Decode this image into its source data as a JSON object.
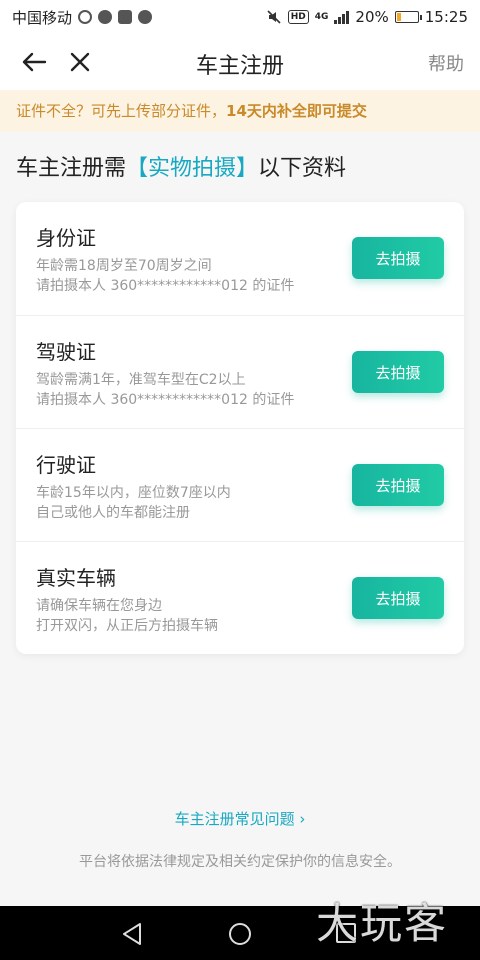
{
  "status_bar": {
    "carrier": "中国移动",
    "hd": "HD",
    "network": "4G",
    "battery": "20%",
    "battery_level": 0.2,
    "time": "15:25"
  },
  "nav": {
    "title": "车主注册",
    "help": "帮助"
  },
  "notice": {
    "text_before": "证件不全？可先上传部分证件，",
    "text_bold": "14天内补全即可提交"
  },
  "headline": {
    "before": "车主注册需",
    "highlight": "【实物拍摄】",
    "after": "以下资料"
  },
  "items": [
    {
      "title": "身份证",
      "desc1": "年龄需18周岁至70周岁之间",
      "desc2": "请拍摄本人 360************012 的证件",
      "button": "去拍摄"
    },
    {
      "title": "驾驶证",
      "desc1": "驾龄需满1年，准驾车型在C2以上",
      "desc2": "请拍摄本人 360************012 的证件",
      "button": "去拍摄"
    },
    {
      "title": "行驶证",
      "desc1": "车龄15年以内，座位数7座以内",
      "desc2": "自己或他人的车都能注册",
      "button": "去拍摄"
    },
    {
      "title": "真实车辆",
      "desc1": "请确保车辆在您身边",
      "desc2": "打开双闪，从正后方拍摄车辆",
      "button": "去拍摄"
    }
  ],
  "faq": {
    "label": "车主注册常见问题",
    "chevron": "›"
  },
  "footer": {
    "note": "平台将依据法律规定及相关约定保护你的信息安全。"
  },
  "watermark": "大玩客",
  "colors": {
    "accent": "#18a9c2",
    "button_start": "#17b5a0",
    "button_end": "#21cba5",
    "notice_bg": "#fcf3e2",
    "notice_text": "#c98a2a"
  }
}
